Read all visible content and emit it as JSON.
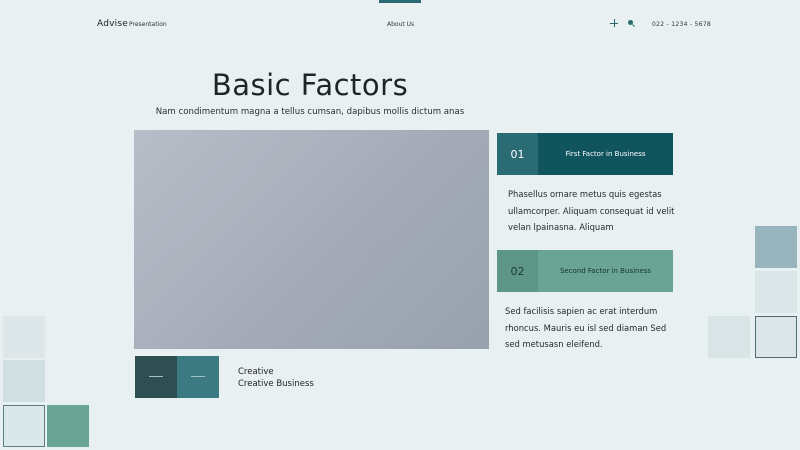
{
  "header": {
    "brand": "Advise",
    "nav_presentation": "Presentation",
    "nav_about": "About Us",
    "phone": "022 - 1234 - 5678",
    "icons": [
      "plus-icon",
      "search-icon"
    ],
    "accent_color": "#2b6a72"
  },
  "main": {
    "title": "Basic Factors",
    "subtitle": "Nam condimentum magna a tellus  cumsan, dapibus mollis dictum anas"
  },
  "factors": [
    {
      "number": "01",
      "label": "First Factor in Business",
      "body": "Phasellus ornare metus quis egestas ullamcorper. Aliquam consequat id velit velan lpainasna. Aliquam"
    },
    {
      "number": "02",
      "label": "Second Factor in Business",
      "body": "Sed facilisis sapien ac erat interdum rhoncus. Mauris eu isl sed diaman Sed sed metusasn eleifend."
    }
  ],
  "creative": {
    "line1": "Creative",
    "line2": "Creative Business"
  },
  "colors": {
    "background": "#e9f0f2",
    "dark_teal": "#10545e",
    "mid_teal": "#2a6b74",
    "sage": "#6aa593"
  }
}
